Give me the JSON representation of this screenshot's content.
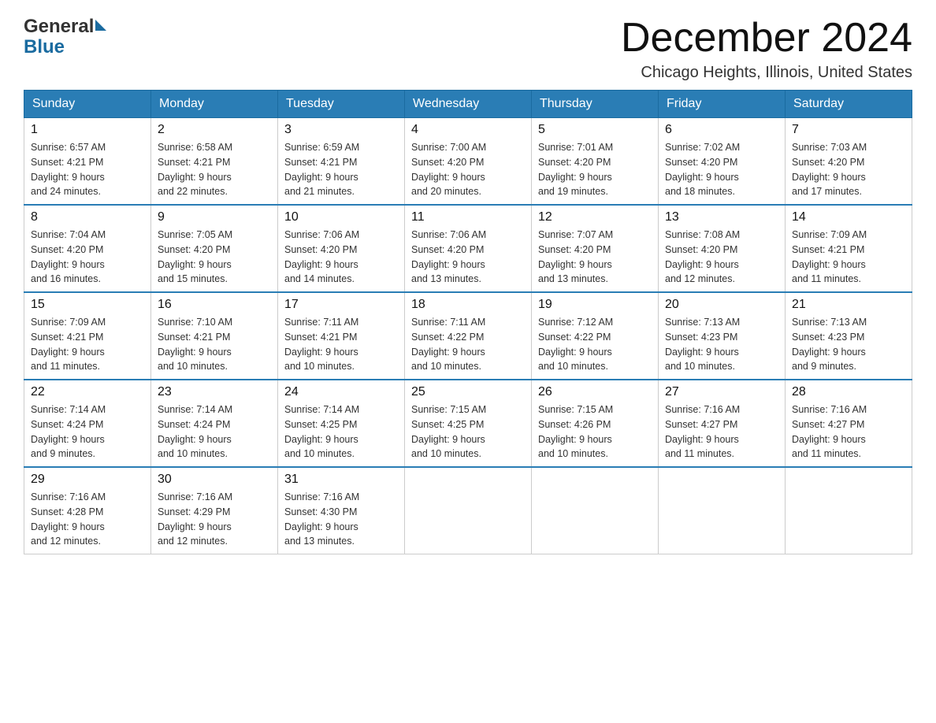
{
  "header": {
    "logo_general": "General",
    "logo_blue": "Blue",
    "title": "December 2024",
    "subtitle": "Chicago Heights, Illinois, United States"
  },
  "days_of_week": [
    "Sunday",
    "Monday",
    "Tuesday",
    "Wednesday",
    "Thursday",
    "Friday",
    "Saturday"
  ],
  "weeks": [
    [
      {
        "day": "1",
        "sunrise": "6:57 AM",
        "sunset": "4:21 PM",
        "daylight": "9 hours and 24 minutes."
      },
      {
        "day": "2",
        "sunrise": "6:58 AM",
        "sunset": "4:21 PM",
        "daylight": "9 hours and 22 minutes."
      },
      {
        "day": "3",
        "sunrise": "6:59 AM",
        "sunset": "4:21 PM",
        "daylight": "9 hours and 21 minutes."
      },
      {
        "day": "4",
        "sunrise": "7:00 AM",
        "sunset": "4:20 PM",
        "daylight": "9 hours and 20 minutes."
      },
      {
        "day": "5",
        "sunrise": "7:01 AM",
        "sunset": "4:20 PM",
        "daylight": "9 hours and 19 minutes."
      },
      {
        "day": "6",
        "sunrise": "7:02 AM",
        "sunset": "4:20 PM",
        "daylight": "9 hours and 18 minutes."
      },
      {
        "day": "7",
        "sunrise": "7:03 AM",
        "sunset": "4:20 PM",
        "daylight": "9 hours and 17 minutes."
      }
    ],
    [
      {
        "day": "8",
        "sunrise": "7:04 AM",
        "sunset": "4:20 PM",
        "daylight": "9 hours and 16 minutes."
      },
      {
        "day": "9",
        "sunrise": "7:05 AM",
        "sunset": "4:20 PM",
        "daylight": "9 hours and 15 minutes."
      },
      {
        "day": "10",
        "sunrise": "7:06 AM",
        "sunset": "4:20 PM",
        "daylight": "9 hours and 14 minutes."
      },
      {
        "day": "11",
        "sunrise": "7:06 AM",
        "sunset": "4:20 PM",
        "daylight": "9 hours and 13 minutes."
      },
      {
        "day": "12",
        "sunrise": "7:07 AM",
        "sunset": "4:20 PM",
        "daylight": "9 hours and 13 minutes."
      },
      {
        "day": "13",
        "sunrise": "7:08 AM",
        "sunset": "4:20 PM",
        "daylight": "9 hours and 12 minutes."
      },
      {
        "day": "14",
        "sunrise": "7:09 AM",
        "sunset": "4:21 PM",
        "daylight": "9 hours and 11 minutes."
      }
    ],
    [
      {
        "day": "15",
        "sunrise": "7:09 AM",
        "sunset": "4:21 PM",
        "daylight": "9 hours and 11 minutes."
      },
      {
        "day": "16",
        "sunrise": "7:10 AM",
        "sunset": "4:21 PM",
        "daylight": "9 hours and 10 minutes."
      },
      {
        "day": "17",
        "sunrise": "7:11 AM",
        "sunset": "4:21 PM",
        "daylight": "9 hours and 10 minutes."
      },
      {
        "day": "18",
        "sunrise": "7:11 AM",
        "sunset": "4:22 PM",
        "daylight": "9 hours and 10 minutes."
      },
      {
        "day": "19",
        "sunrise": "7:12 AM",
        "sunset": "4:22 PM",
        "daylight": "9 hours and 10 minutes."
      },
      {
        "day": "20",
        "sunrise": "7:13 AM",
        "sunset": "4:23 PM",
        "daylight": "9 hours and 10 minutes."
      },
      {
        "day": "21",
        "sunrise": "7:13 AM",
        "sunset": "4:23 PM",
        "daylight": "9 hours and 9 minutes."
      }
    ],
    [
      {
        "day": "22",
        "sunrise": "7:14 AM",
        "sunset": "4:24 PM",
        "daylight": "9 hours and 9 minutes."
      },
      {
        "day": "23",
        "sunrise": "7:14 AM",
        "sunset": "4:24 PM",
        "daylight": "9 hours and 10 minutes."
      },
      {
        "day": "24",
        "sunrise": "7:14 AM",
        "sunset": "4:25 PM",
        "daylight": "9 hours and 10 minutes."
      },
      {
        "day": "25",
        "sunrise": "7:15 AM",
        "sunset": "4:25 PM",
        "daylight": "9 hours and 10 minutes."
      },
      {
        "day": "26",
        "sunrise": "7:15 AM",
        "sunset": "4:26 PM",
        "daylight": "9 hours and 10 minutes."
      },
      {
        "day": "27",
        "sunrise": "7:16 AM",
        "sunset": "4:27 PM",
        "daylight": "9 hours and 11 minutes."
      },
      {
        "day": "28",
        "sunrise": "7:16 AM",
        "sunset": "4:27 PM",
        "daylight": "9 hours and 11 minutes."
      }
    ],
    [
      {
        "day": "29",
        "sunrise": "7:16 AM",
        "sunset": "4:28 PM",
        "daylight": "9 hours and 12 minutes."
      },
      {
        "day": "30",
        "sunrise": "7:16 AM",
        "sunset": "4:29 PM",
        "daylight": "9 hours and 12 minutes."
      },
      {
        "day": "31",
        "sunrise": "7:16 AM",
        "sunset": "4:30 PM",
        "daylight": "9 hours and 13 minutes."
      },
      null,
      null,
      null,
      null
    ]
  ],
  "labels": {
    "sunrise": "Sunrise:",
    "sunset": "Sunset:",
    "daylight": "Daylight:"
  }
}
